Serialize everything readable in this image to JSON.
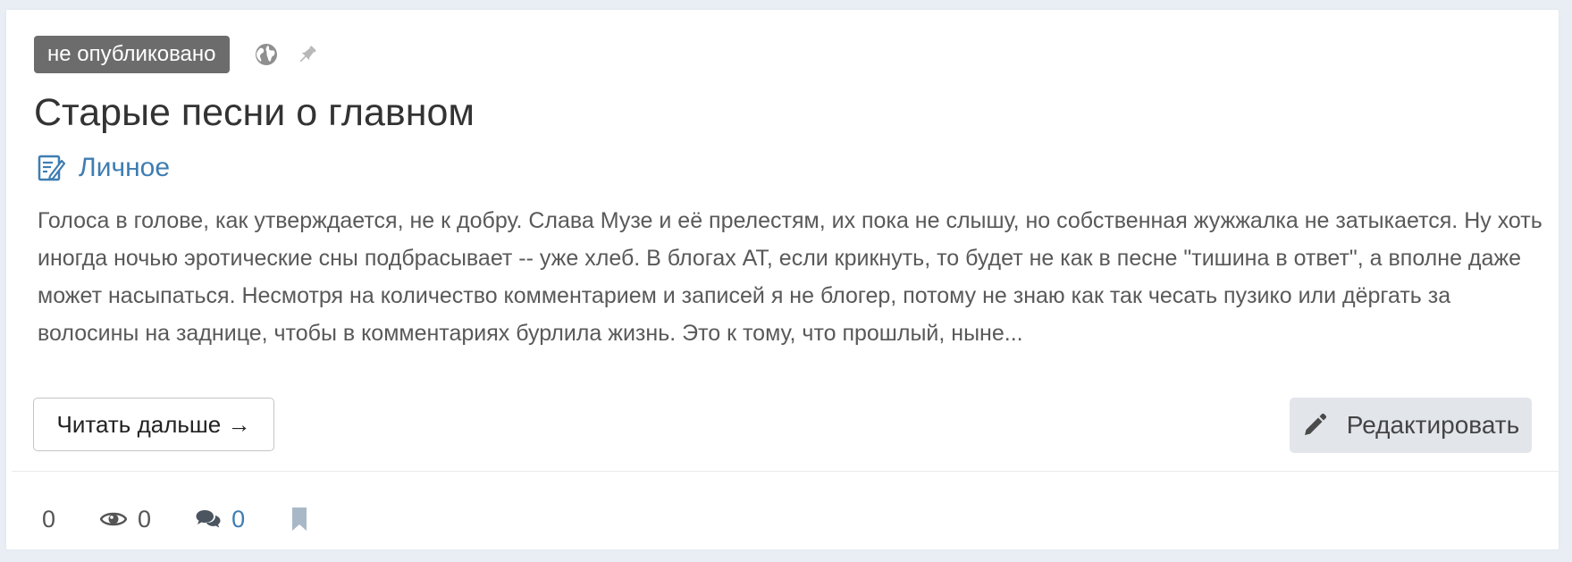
{
  "post": {
    "status_badge": "не опубликовано",
    "title": "Старые песни о главном",
    "category": "Личное",
    "excerpt": "Голоса в голове, как утверждается, не к добру. Слава Музе и её прелестям, их пока не слышу, но собственная жужжалка не затыкается. Ну хоть иногда ночью эротические сны подбрасывает -- уже хлеб. В блогах АТ, если крикнуть, то будет не как в песне \"тишина в ответ\", а вполне даже может насыпаться. Несмотря на количество комментарием и записей я не блогер, потому не знаю как так чесать пузико или дёргать за волосины на заднице, чтобы в комментариях бурлила жизнь. Это к тому, что прошлый, ныне...",
    "read_more_label": "Читать дальше →",
    "edit_label": "Редактировать"
  },
  "icons": {
    "visibility": "globe-icon",
    "pin": "pin-icon",
    "category": "blog-post-icon",
    "edit": "pencil-icon",
    "views": "eye-icon",
    "comments": "comments-icon",
    "bookmark": "bookmark-icon"
  },
  "stats": {
    "rating": "0",
    "views": "0",
    "comments": "0"
  },
  "colors": {
    "badge_bg": "#6c6c6c",
    "link": "#3e7db2",
    "edit_button_bg": "#e2e6eb",
    "bookmark": "#a9b8c6",
    "page_bg": "#e9eef5"
  }
}
